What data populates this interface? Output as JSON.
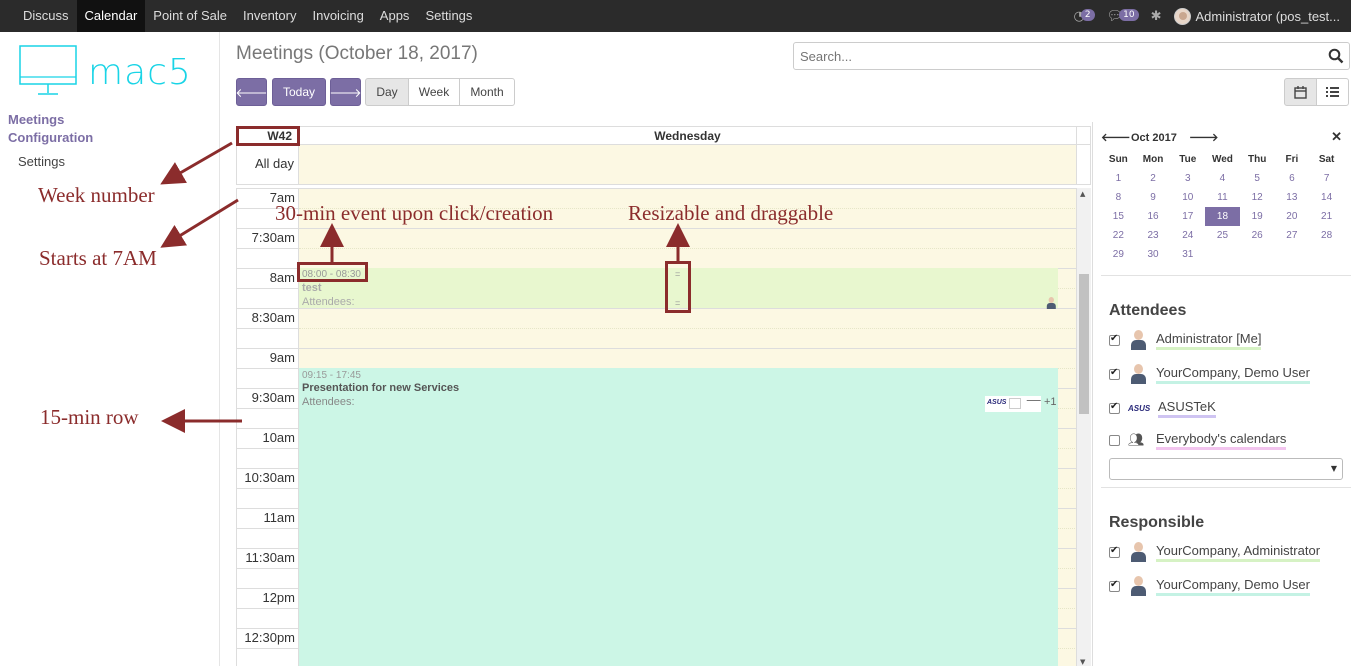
{
  "topbar": {
    "menu": [
      "Discuss",
      "Calendar",
      "Point of Sale",
      "Inventory",
      "Invoicing",
      "Apps",
      "Settings"
    ],
    "active": "Calendar",
    "activity_count": "2",
    "messages_count": "10",
    "user": "Administrator (pos_test..."
  },
  "sidebar": {
    "logo_text": "mac5",
    "meetings": "Meetings",
    "configuration": "Configuration",
    "settings": "Settings"
  },
  "header": {
    "title": "Meetings (October 18, 2017)",
    "search_placeholder": "Search...",
    "today_label": "Today",
    "day_label": "Day",
    "week_label": "Week",
    "month_label": "Month"
  },
  "calendar": {
    "week": "W42",
    "day_name": "Wednesday",
    "all_day": "All day",
    "times": [
      "7am",
      "7:30am",
      "8am",
      "8:30am",
      "9am",
      "9:30am",
      "10am",
      "10:30am",
      "11am",
      "11:30am",
      "12pm",
      "12:30pm"
    ],
    "events": [
      {
        "time": "08:00 - 08:30",
        "name": "test",
        "attendees": "Attendees:",
        "color": "#e8f7cf"
      },
      {
        "time": "09:15 - 17:45",
        "name": "Presentation for new Services",
        "attendees": "Attendees:",
        "extra": "+1",
        "color": "#ccf6e6"
      }
    ]
  },
  "annotations": {
    "week_number": "Week number",
    "starts": "Starts at 7AM",
    "thirty_min": "30-min event upon click/creation",
    "resizable": "Resizable and draggable",
    "fifteen_min": "15-min row"
  },
  "mini_calendar": {
    "month": "Oct 2017",
    "weekdays": [
      "Sun",
      "Mon",
      "Tue",
      "Wed",
      "Thu",
      "Fri",
      "Sat"
    ],
    "weeks": [
      [
        "1",
        "2",
        "3",
        "4",
        "5",
        "6",
        "7"
      ],
      [
        "8",
        "9",
        "10",
        "11",
        "12",
        "13",
        "14"
      ],
      [
        "15",
        "16",
        "17",
        "18",
        "19",
        "20",
        "21"
      ],
      [
        "22",
        "23",
        "24",
        "25",
        "26",
        "27",
        "28"
      ],
      [
        "29",
        "30",
        "31",
        "",
        "",
        "",
        ""
      ]
    ],
    "selected": "18"
  },
  "attendees": {
    "title": "Attendees",
    "items": [
      {
        "name": "Administrator [Me]",
        "checked": true,
        "color": "#d6f2c4"
      },
      {
        "name": "YourCompany, Demo User",
        "checked": true,
        "color": "#c4f2e4"
      },
      {
        "name": "ASUSTeK",
        "checked": true,
        "color": "#cfc4f2"
      },
      {
        "name": "Everybody's calendars",
        "checked": false,
        "color": "#f2c4ee"
      }
    ]
  },
  "responsible": {
    "title": "Responsible",
    "items": [
      {
        "name": "YourCompany, Administrator",
        "checked": true,
        "color": "#d6f2c4"
      },
      {
        "name": "YourCompany, Demo User",
        "checked": true,
        "color": "#c4f2e4"
      }
    ]
  }
}
